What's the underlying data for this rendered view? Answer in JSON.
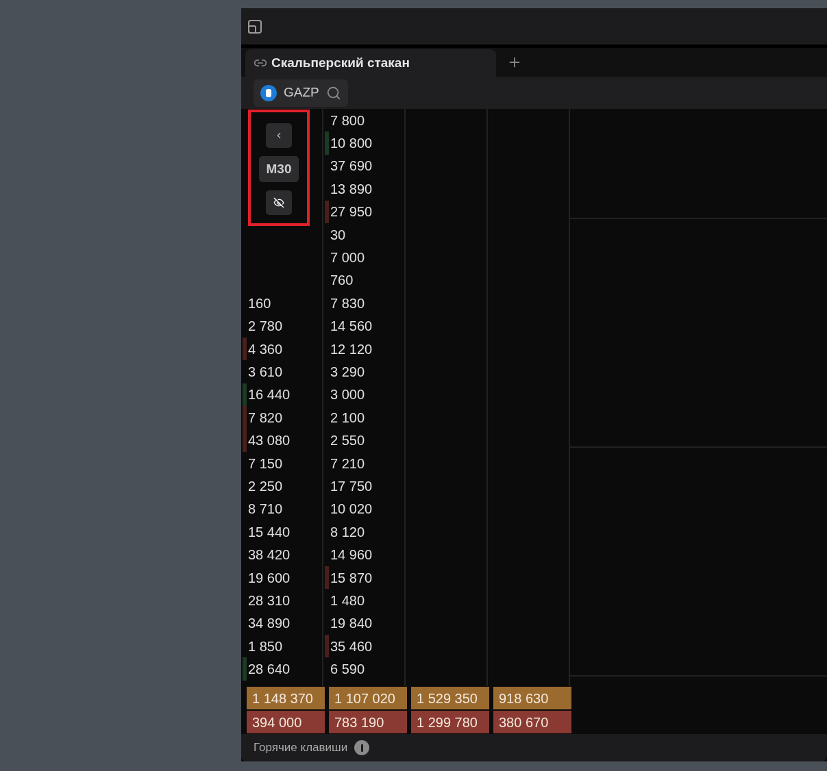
{
  "tabs": [
    {
      "label": "Скальперский стакан",
      "selected": true
    }
  ],
  "ticker": {
    "symbol": "GAZP"
  },
  "controls": {
    "timeframe": "M30"
  },
  "columns": [
    {
      "cells": [
        {
          "value": "160"
        },
        {
          "value": "2 780"
        },
        {
          "value": "4 360",
          "color": "#4a1f1c"
        },
        {
          "value": "3 610"
        },
        {
          "value": "16 440",
          "color": "#1c3a24"
        },
        {
          "value": "7 820",
          "color": "#4a1f1c"
        },
        {
          "value": "43 080",
          "color": "#4a1f1c"
        },
        {
          "value": "7 150"
        },
        {
          "value": "2 250"
        },
        {
          "value": "8 710"
        },
        {
          "value": "15 440"
        },
        {
          "value": "38 420"
        },
        {
          "value": "19 600"
        },
        {
          "value": "28 310"
        },
        {
          "value": "34 890"
        },
        {
          "value": "1 850"
        },
        {
          "value": "28 640",
          "color": "#1c3a24"
        }
      ]
    },
    {
      "cells": [
        {
          "value": "7 800"
        },
        {
          "value": "10 800",
          "color": "#1c3a24"
        },
        {
          "value": "37 690"
        },
        {
          "value": "13 890"
        },
        {
          "value": "27 950",
          "color": "#4a1f1c"
        },
        {
          "value": "30"
        },
        {
          "value": "7 000"
        },
        {
          "value": "760"
        },
        {
          "value": "7 830"
        },
        {
          "value": "14 560"
        },
        {
          "value": "12 120"
        },
        {
          "value": "3 290"
        },
        {
          "value": "3 000"
        },
        {
          "value": "2 100"
        },
        {
          "value": "2 550"
        },
        {
          "value": "7 210"
        },
        {
          "value": "17 750"
        },
        {
          "value": "10 020"
        },
        {
          "value": "8 120"
        },
        {
          "value": "14 960"
        },
        {
          "value": "15 870",
          "color": "#4a1f1c"
        },
        {
          "value": "1 480"
        },
        {
          "value": "19 840"
        },
        {
          "value": "35 460",
          "color": "#4a1f1c"
        },
        {
          "value": "6 590"
        }
      ]
    },
    {},
    {}
  ],
  "totals": [
    {
      "kind": "buy",
      "values": [
        "1 148 370",
        "1 107 020",
        "1 529 350",
        "918 630"
      ]
    },
    {
      "kind": "sell",
      "values": [
        "394 000",
        "783 190",
        "1 299 780",
        "380 670"
      ]
    }
  ],
  "footer": {
    "label": "Горячие клавиши"
  }
}
